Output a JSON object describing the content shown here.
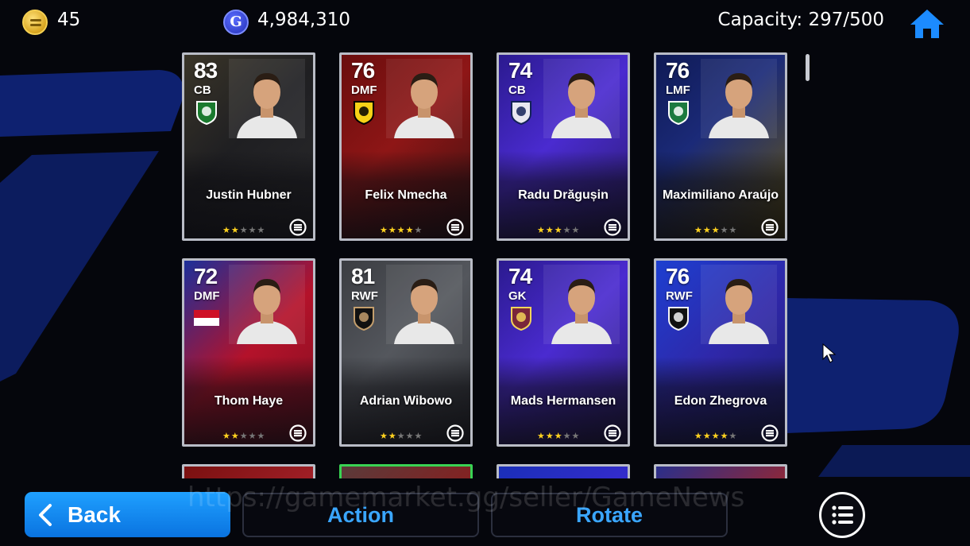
{
  "topbar": {
    "coins": "45",
    "gp": "4,984,310",
    "gp_icon_letter": "G",
    "capacity": "Capacity: 297/500"
  },
  "cards": [
    {
      "rating": "83",
      "position": "CB",
      "name": "Justin Hubner",
      "stars": 2,
      "theme": "gold-dark",
      "badge": "fortuna-badge-icon"
    },
    {
      "rating": "76",
      "position": "DMF",
      "name": "Felix Nmecha",
      "stars": 4,
      "theme": "red",
      "badge": "bvb-badge-icon"
    },
    {
      "rating": "74",
      "position": "CB",
      "name": "Radu Drăgușin",
      "stars": 3,
      "theme": "purple",
      "badge": "tottenham-badge-icon"
    },
    {
      "rating": "76",
      "position": "LMF",
      "name": "Maximiliano Araújo",
      "stars": 3,
      "theme": "navy-gold",
      "badge": "sporting-badge-icon"
    },
    {
      "rating": "72",
      "position": "DMF",
      "name": "Thom Haye",
      "stars": 2,
      "theme": "red-blue",
      "badge": "indonesia-flag-icon"
    },
    {
      "rating": "81",
      "position": "RWF",
      "name": "Adrian Wibowo",
      "stars": 2,
      "theme": "grey",
      "badge": "lafc-badge-icon"
    },
    {
      "rating": "74",
      "position": "GK",
      "name": "Mads Hermansen",
      "stars": 3,
      "theme": "purple",
      "badge": "westham-badge-icon"
    },
    {
      "rating": "76",
      "position": "RWF",
      "name": "Edon Zhegrova",
      "stars": 4,
      "theme": "blue",
      "badge": "juventus-badge-icon"
    }
  ],
  "buttons": {
    "back": "Back",
    "action": "Action",
    "rotate": "Rotate"
  },
  "watermark": "https://gamemarket.gg/seller/GameNews",
  "colors": {
    "accent_blue": "#0a73e0",
    "action_text": "#3aa6ff",
    "star_on": "#ffd21f"
  }
}
